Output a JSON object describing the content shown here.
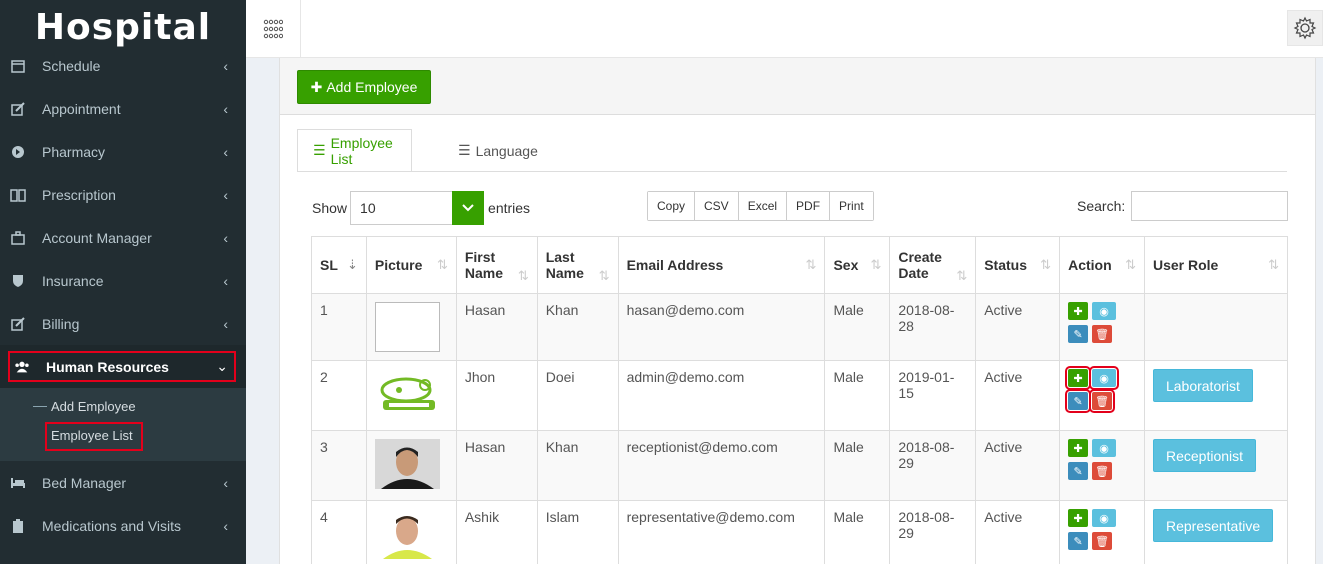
{
  "brand": {
    "logo_text": "Hospital"
  },
  "sidebar": {
    "items": [
      {
        "label": "Schedule",
        "icon": "calendar-icon"
      },
      {
        "label": "Appointment",
        "icon": "edit-icon"
      },
      {
        "label": "Pharmacy",
        "icon": "arrow-circle-icon"
      },
      {
        "label": "Prescription",
        "icon": "book-icon"
      },
      {
        "label": "Account Manager",
        "icon": "briefcase-icon"
      },
      {
        "label": "Insurance",
        "icon": "shield-icon"
      },
      {
        "label": "Billing",
        "icon": "pencil-square-icon"
      },
      {
        "label": "Human Resources",
        "icon": "users-icon"
      },
      {
        "label": "Bed Manager",
        "icon": "bed-icon"
      },
      {
        "label": "Medications and Visits",
        "icon": "clipboard-icon"
      }
    ],
    "submenu": [
      "Add Employee",
      "Employee List"
    ]
  },
  "toolbar": {
    "add_employee": "Add Employee"
  },
  "tabs": [
    "Employee List",
    "Language"
  ],
  "controls": {
    "show_label": "Show",
    "page_size": "10",
    "entries_label": "entries",
    "export": [
      "Copy",
      "CSV",
      "Excel",
      "PDF",
      "Print"
    ],
    "search_label": "Search:"
  },
  "table": {
    "headers": {
      "sl": "SL",
      "picture": "Picture",
      "first1": "First",
      "first2": "Name",
      "last1": "Last",
      "last2": "Name",
      "email": "Email Address",
      "sex": "Sex",
      "date1": "Create",
      "date2": "Date",
      "status": "Status",
      "action": "Action",
      "role": "User Role"
    },
    "rows": [
      {
        "sl": "1",
        "first": "Hasan",
        "last": "Khan",
        "email": "hasan@demo.com",
        "sex": "Male",
        "date1": "2018-08-",
        "date2": "28",
        "status": "Active",
        "role": ""
      },
      {
        "sl": "2",
        "first": "Jhon",
        "last": "Doei",
        "email": "admin@demo.com",
        "sex": "Male",
        "date1": "2019-01-",
        "date2": "15",
        "status": "Active",
        "role": "Laboratorist"
      },
      {
        "sl": "3",
        "first": "Hasan",
        "last": "Khan",
        "email": "receptionist@demo.com",
        "sex": "Male",
        "date1": "2018-08-",
        "date2": "29",
        "status": "Active",
        "role": "Receptionist"
      },
      {
        "sl": "4",
        "first": "Ashik",
        "last": "Islam",
        "email": "representative@demo.com",
        "sex": "Male",
        "date1": "2018-08-",
        "date2": "29",
        "status": "Active",
        "role": "Representative"
      }
    ]
  },
  "colors": {
    "sidebar_bg": "#222d32",
    "accent_green": "#37a000",
    "info_blue": "#5bc0de",
    "highlight_red": "#e3001b"
  }
}
